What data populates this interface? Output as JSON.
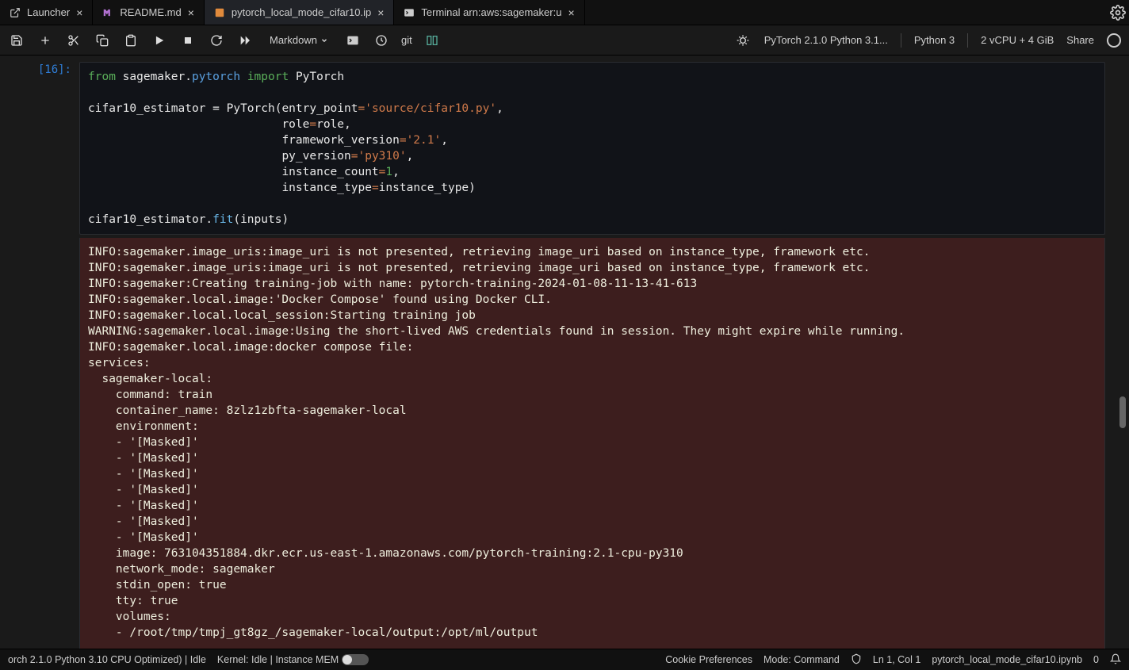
{
  "tabs": [
    {
      "label": "Launcher",
      "closable": true
    },
    {
      "label": "README.md",
      "closable": true
    },
    {
      "label": "pytorch_local_mode_cifar10.ip",
      "closable": true,
      "active": true
    },
    {
      "label": "Terminal arn:aws:sagemaker:u",
      "closable": true
    }
  ],
  "toolbar": {
    "cell_type": "Markdown",
    "git_label": "git"
  },
  "kernel": {
    "env": "PyTorch 2.1.0 Python 3.1...",
    "lang": "Python 3",
    "compute": "2 vCPU + 4 GiB",
    "share": "Share"
  },
  "cell": {
    "prompt": "[16]:",
    "code": {
      "l1_from": "from",
      "l1_pkg": "sagemaker",
      "l1_dot": ".",
      "l1_sub": "pytorch",
      "l1_import": "import",
      "l1_cls": "PyTorch",
      "l3_var": "cifar10_estimator",
      "l3_eq": " = ",
      "l3_cls": "PyTorch",
      "l3_open": "(",
      "l3_k1": "entry_point",
      "l3_v1": "'source/cifar10.py'",
      "pad": "                            ",
      "l4_k": "role",
      "l4_v": "role",
      "l5_k": "framework_version",
      "l5_v": "'2.1'",
      "l6_k": "py_version",
      "l6_v": "'py310'",
      "l7_k": "instance_count",
      "l7_v": "1",
      "l8_k": "instance_type",
      "l8_v": "instance_type",
      "l8_close": ")",
      "l10_var": "cifar10_estimator",
      "l10_dot": ".",
      "l10_fn": "fit",
      "l10_args": "(inputs)"
    }
  },
  "output": {
    "lines": [
      "INFO:sagemaker.image_uris:image_uri is not presented, retrieving image_uri based on instance_type, framework etc.",
      "INFO:sagemaker.image_uris:image_uri is not presented, retrieving image_uri based on instance_type, framework etc.",
      "INFO:sagemaker:Creating training-job with name: pytorch-training-2024-01-08-11-13-41-613",
      "INFO:sagemaker.local.image:'Docker Compose' found using Docker CLI.",
      "INFO:sagemaker.local.local_session:Starting training job",
      "WARNING:sagemaker.local.image:Using the short-lived AWS credentials found in session. They might expire while running.",
      "INFO:sagemaker.local.image:docker compose file:",
      "services:",
      "  sagemaker-local:",
      "    command: train",
      "    container_name: 8zlz1zbfta-sagemaker-local",
      "    environment:",
      "    - '[Masked]'",
      "    - '[Masked]'",
      "    - '[Masked]'",
      "    - '[Masked]'",
      "    - '[Masked]'",
      "    - '[Masked]'",
      "    - '[Masked]'",
      "    image: 763104351884.dkr.ecr.us-east-1.amazonaws.com/pytorch-training:2.1-cpu-py310",
      "    network_mode: sagemaker",
      "    stdin_open: true",
      "    tty: true",
      "    volumes:",
      "    - /root/tmp/tmpj_gt8gz_/sagemaker-local/output:/opt/ml/output"
    ]
  },
  "status": {
    "left1": "orch 2.1.0 Python 3.10 CPU Optimized) | Idle",
    "kernel": "Kernel: Idle | Instance MEM",
    "cookie": "Cookie Preferences",
    "mode": "Mode: Command",
    "pos": "Ln 1, Col 1",
    "file": "pytorch_local_mode_cifar10.ipynb",
    "notif": "0"
  }
}
